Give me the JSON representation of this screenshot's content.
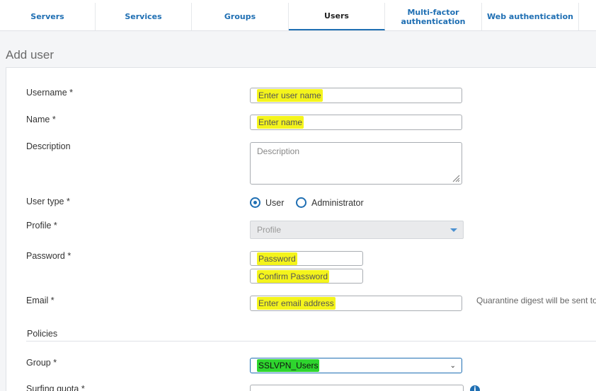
{
  "tabs": [
    {
      "label": "Servers"
    },
    {
      "label": "Services"
    },
    {
      "label": "Groups"
    },
    {
      "label": "Users"
    },
    {
      "label_line1": "Multi-factor",
      "label_line2": "authentication"
    },
    {
      "label": "Web authentication"
    }
  ],
  "page": {
    "title": "Add user"
  },
  "form": {
    "username": {
      "label": "Username *",
      "placeholder": "Enter user name"
    },
    "name": {
      "label": "Name *",
      "placeholder": "Enter name"
    },
    "description": {
      "label": "Description",
      "placeholder": "Description"
    },
    "user_type": {
      "label": "User type *",
      "options": [
        "User",
        "Administrator"
      ],
      "selected": "User"
    },
    "profile": {
      "label": "Profile *",
      "value": "Profile"
    },
    "password": {
      "label": "Password *",
      "placeholder": "Password",
      "confirm_placeholder": "Confirm Password"
    },
    "email": {
      "label": "Email *",
      "placeholder": "Enter email address",
      "note": "Quarantine digest will be sent to"
    },
    "policies": {
      "title": "Policies"
    },
    "group": {
      "label": "Group *",
      "value": "SSLVPN_Users"
    },
    "surfing_quota": {
      "label": "Surfing quota *"
    }
  },
  "colors": {
    "accent": "#1f6fb3",
    "highlight_yellow": "#f4f41c",
    "highlight_green": "#2ed52e"
  }
}
